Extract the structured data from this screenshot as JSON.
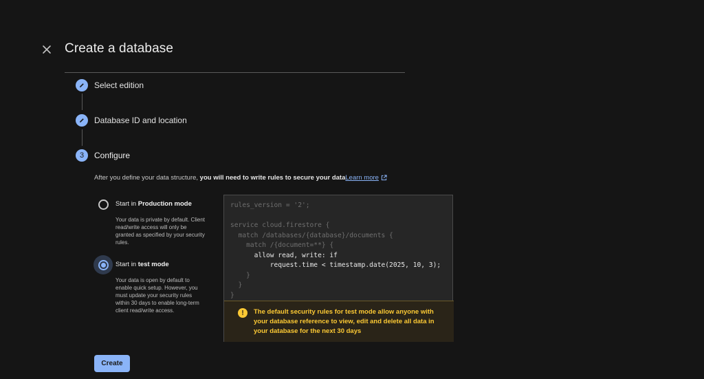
{
  "dialog": {
    "title": "Create a database",
    "close_icon": "close-icon"
  },
  "steps": [
    {
      "label": "Select edition",
      "icon": "pencil-icon",
      "state": "completed"
    },
    {
      "label": "Database ID and location",
      "icon": "pencil-icon",
      "state": "completed"
    },
    {
      "number": "3",
      "label": "Configure",
      "state": "active"
    }
  ],
  "configure": {
    "info_prefix": "After you define your data structure, ",
    "info_bold": "you will need to write rules to secure your data",
    "learn_more": "Learn more",
    "options": [
      {
        "prefix": "Start in ",
        "bold": "Production mode",
        "description": "Your data is private by default. Client read/write access will only be granted as specified by your security rules.",
        "selected": false
      },
      {
        "prefix": "Start in ",
        "bold": "test mode",
        "description": "Your data is open by default to enable quick setup. However, you must update your security rules within 30 days to enable long-term client read/write access.",
        "selected": true
      }
    ]
  },
  "rules_code": {
    "lines": [
      "rules_version = '2';",
      "",
      "service cloud.firestore {",
      "  match /databases/{database}/documents {",
      "    match /{document=**} {",
      "      allow read, write: if",
      "          request.time < timestamp.date(2025, 10, 3);",
      "    }",
      "  }",
      "}"
    ]
  },
  "warning": {
    "icon": "warning-icon",
    "text": "The default security rules for test mode allow anyone with your database reference to view, edit and delete all data in your database for the next 30 days",
    "color": "#fcc934"
  },
  "actions": {
    "create_label": "Create"
  },
  "colors": {
    "accent": "#8ab4f8",
    "background": "#151515",
    "warning": "#fcc934"
  }
}
